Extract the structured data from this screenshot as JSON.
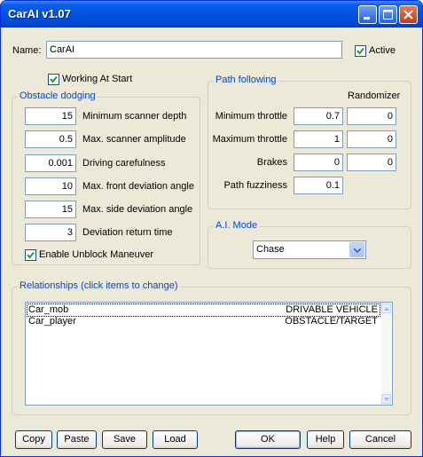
{
  "window": {
    "title": "CarAI v1.07"
  },
  "name_row": {
    "label": "Name:",
    "value": "CarAI",
    "active_label": "Active",
    "active_checked": true
  },
  "working_at_start": {
    "label": "Working At Start",
    "checked": true
  },
  "obstacle_dodging": {
    "title": "Obstacle dodging",
    "fields": [
      {
        "value": "15",
        "label": "Minimum scanner depth"
      },
      {
        "value": "0.5",
        "label": "Max. scanner amplitude"
      },
      {
        "value": "0.001",
        "label": "Driving carefulness"
      },
      {
        "value": "10",
        "label": "Max. front deviation angle"
      },
      {
        "value": "15",
        "label": "Max. side deviation angle"
      },
      {
        "value": "3",
        "label": "Deviation return time"
      }
    ],
    "unblock": {
      "label": "Enable Unblock Maneuver",
      "checked": true
    }
  },
  "path_following": {
    "title": "Path following",
    "randomizer_label": "Randomizer",
    "rows": [
      {
        "label": "Minimum throttle",
        "value": "0.7",
        "random": "0"
      },
      {
        "label": "Maximum throttle",
        "value": "1",
        "random": "0"
      },
      {
        "label": "Brakes",
        "value": "0",
        "random": "0"
      },
      {
        "label": "Path fuzziness",
        "value": "0.1"
      }
    ]
  },
  "ai_mode": {
    "title": "A.I. Mode",
    "selected": "Chase"
  },
  "relationships": {
    "title": "Relationships (click items to change)",
    "items": [
      {
        "name": "Car_mob",
        "relation": "DRIVABLE VEHICLE"
      },
      {
        "name": "Car_player",
        "relation": "OBSTACLE/TARGET"
      }
    ]
  },
  "buttons": {
    "copy": "Copy",
    "paste": "Paste",
    "save": "Save",
    "load": "Load",
    "ok": "OK",
    "help": "Help",
    "cancel": "Cancel"
  },
  "colors": {
    "titlebar": "#0054e3",
    "group_title": "#0046d5",
    "dialog_bg": "#ece9d8"
  }
}
